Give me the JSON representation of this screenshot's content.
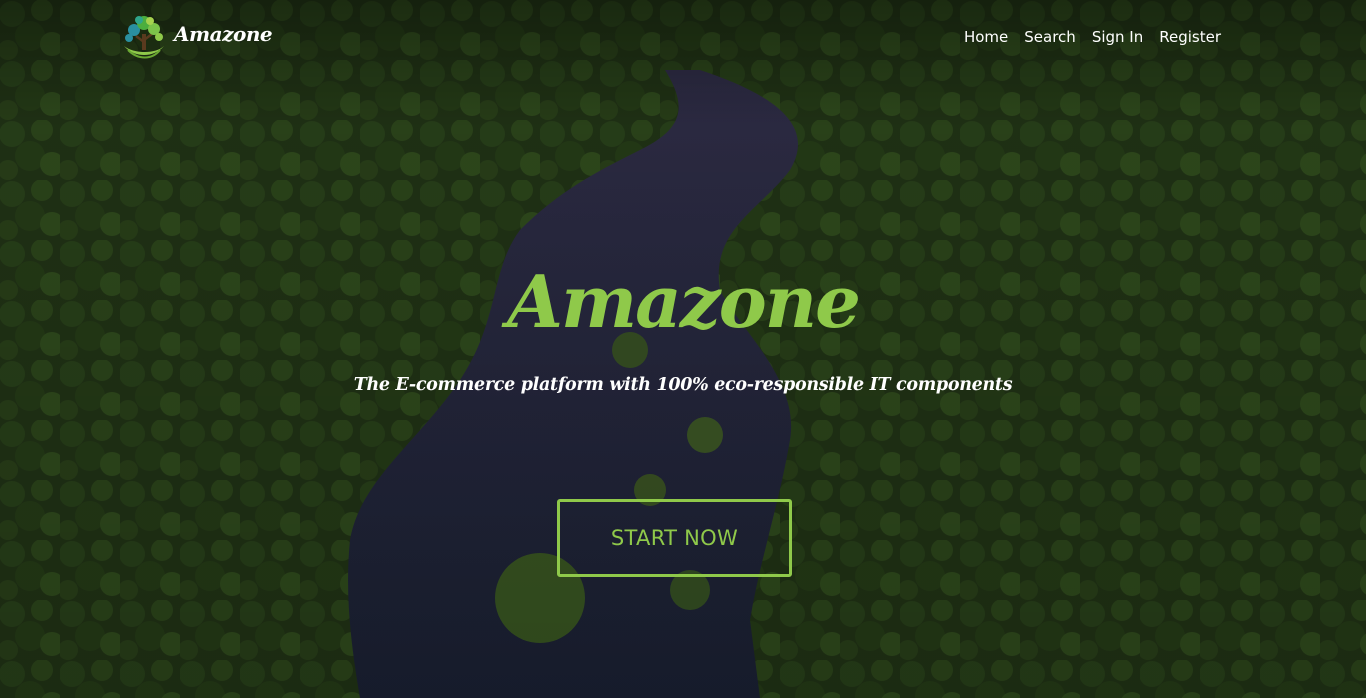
{
  "nav": {
    "brand": "Amazone",
    "logo_icon": "tree-logo-icon",
    "links": [
      "Home",
      "Search",
      "Sign In",
      "Register"
    ]
  },
  "hero": {
    "title": "Amazone",
    "subtitle": "The E-commerce platform with 100% eco-responsible IT components",
    "cta_label": "START NOW",
    "background": "aerial-rainforest-river-photo"
  },
  "colors": {
    "accent": "#8fc94a",
    "text": "#ffffff"
  }
}
